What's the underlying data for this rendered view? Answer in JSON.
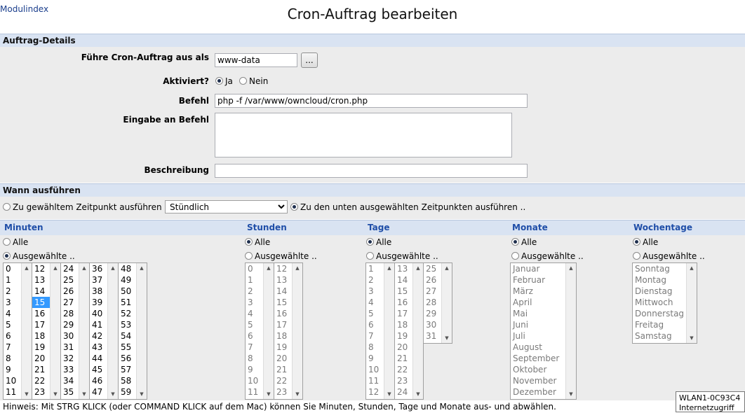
{
  "header": {
    "module_index": "Modulindex",
    "title": "Cron-Auftrag bearbeiten"
  },
  "details": {
    "section_title": "Auftrag-Details",
    "run_as_label": "Führe Cron-Auftrag aus als",
    "run_as_value": "www-data",
    "browse_button": "...",
    "active_label": "Aktiviert?",
    "active_yes": "Ja",
    "active_no": "Nein",
    "active_selected": "Ja",
    "command_label": "Befehl",
    "command_value": "php -f /var/www/owncloud/cron.php",
    "input_label": "Eingabe an Befehl",
    "input_value": "",
    "description_label": "Beschreibung",
    "description_value": ""
  },
  "schedule": {
    "section_title": "Wann ausführen",
    "option_preset": "Zu gewähltem Zeitpunkt ausführen ..",
    "preset_value": "Stündlich",
    "option_selected_times": "Zu den unten ausgewählten Zeitpunkten ausführen ..",
    "mode_selected": "selected_times",
    "all_label": "Alle",
    "selected_label": "Ausgewählte ..",
    "columns": {
      "minutes": {
        "title": "Minuten",
        "mode": "selected",
        "lists": [
          [
            "0",
            "1",
            "2",
            "3",
            "4",
            "5",
            "6",
            "7",
            "8",
            "9",
            "10",
            "11"
          ],
          [
            "12",
            "13",
            "14",
            "15",
            "16",
            "17",
            "18",
            "19",
            "20",
            "21",
            "22",
            "23"
          ],
          [
            "24",
            "25",
            "26",
            "27",
            "28",
            "29",
            "30",
            "31",
            "32",
            "33",
            "34",
            "35"
          ],
          [
            "36",
            "37",
            "38",
            "39",
            "40",
            "41",
            "42",
            "43",
            "44",
            "45",
            "46",
            "47"
          ],
          [
            "48",
            "49",
            "50",
            "51",
            "52",
            "53",
            "54",
            "55",
            "56",
            "57",
            "58",
            "59"
          ]
        ],
        "selected_value": "15"
      },
      "hours": {
        "title": "Stunden",
        "mode": "all",
        "lists": [
          [
            "0",
            "1",
            "2",
            "3",
            "4",
            "5",
            "6",
            "7",
            "8",
            "9",
            "10",
            "11"
          ],
          [
            "12",
            "13",
            "14",
            "15",
            "16",
            "17",
            "18",
            "19",
            "20",
            "21",
            "22",
            "23"
          ]
        ]
      },
      "days": {
        "title": "Tage",
        "mode": "all",
        "lists": [
          [
            "1",
            "2",
            "3",
            "4",
            "5",
            "6",
            "7",
            "8",
            "9",
            "10",
            "11",
            "12"
          ],
          [
            "13",
            "14",
            "15",
            "16",
            "17",
            "18",
            "19",
            "20",
            "21",
            "22",
            "23",
            "24"
          ],
          [
            "25",
            "26",
            "27",
            "28",
            "29",
            "30",
            "31"
          ]
        ]
      },
      "months": {
        "title": "Monate",
        "mode": "all",
        "lists": [
          [
            "Januar",
            "Februar",
            "März",
            "April",
            "Mai",
            "Juni",
            "Juli",
            "August",
            "September",
            "Oktober",
            "November",
            "Dezember"
          ]
        ]
      },
      "weekdays": {
        "title": "Wochentage",
        "mode": "all",
        "lists": [
          [
            "Sonntag",
            "Montag",
            "Dienstag",
            "Mittwoch",
            "Donnerstag",
            "Freitag",
            "Samstag"
          ]
        ]
      }
    }
  },
  "hint": "Hinweis: Mit STRG KLICK (oder COMMAND KLICK auf dem Mac) können Sie Minuten, Stunden, Tage und Monate aus- und abwählen.",
  "tooltip": {
    "line1": "WLAN1-0C93C4",
    "line2": "Internetzugriff"
  }
}
